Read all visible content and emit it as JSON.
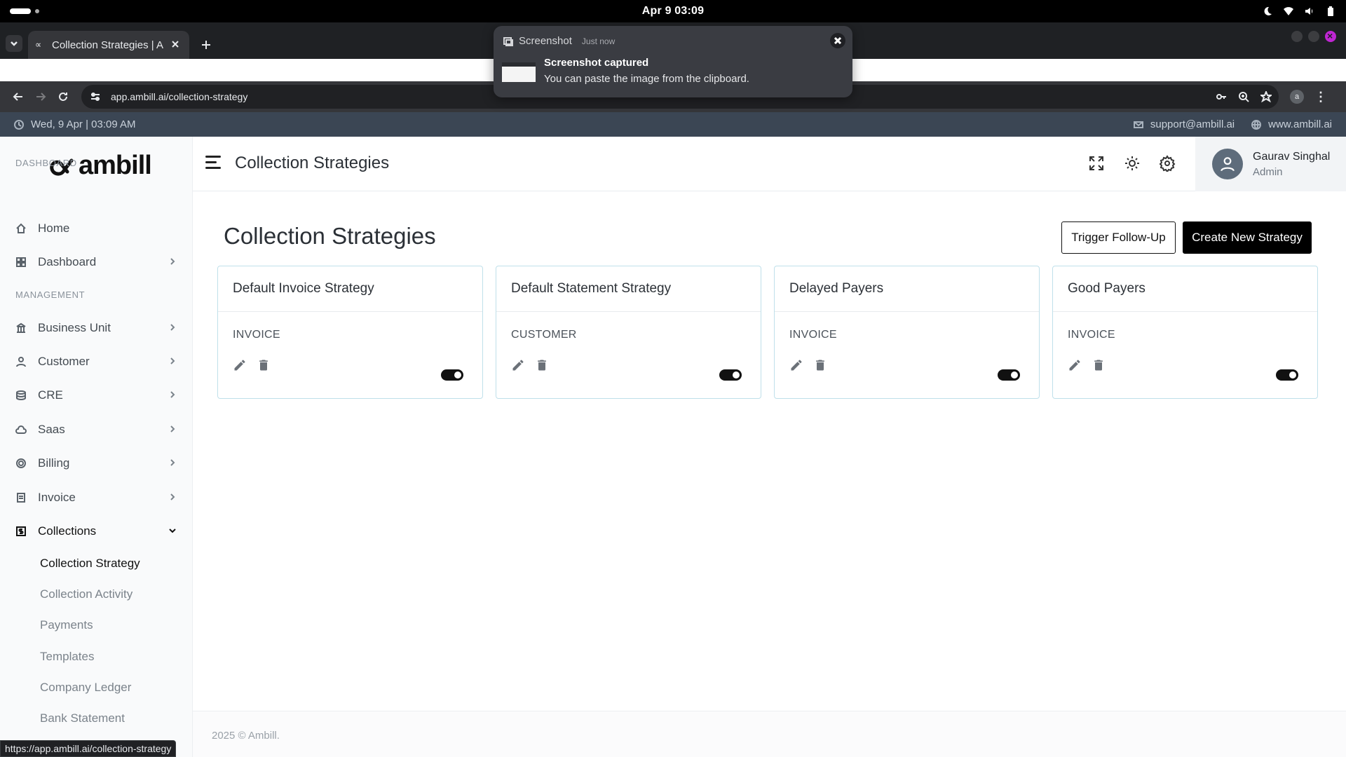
{
  "os": {
    "clock": "Apr 9  03:09"
  },
  "browser": {
    "tab_title": "Collection Strategies | Ar",
    "tab_favicon": "∝",
    "url": "app.ambill.ai/collection-strategy",
    "profile_initial": "a",
    "status_url": "https://app.ambill.ai/collection-strategy"
  },
  "notification": {
    "app": "Screenshot",
    "time": "Just now",
    "title": "Screenshot captured",
    "body": "You can paste the image from the clipboard."
  },
  "infobar": {
    "datetime": "Wed, 9 Apr | 03:09 AM",
    "support_email": "support@ambill.ai",
    "website": "www.ambill.ai"
  },
  "sidebar": {
    "logo": "ambill",
    "section_dashboard": "DASHBOARD",
    "section_management": "MANAGEMENT",
    "items": [
      {
        "label": "Home",
        "icon": "home-icon"
      },
      {
        "label": "Dashboard",
        "icon": "grid-icon"
      },
      {
        "label": "Business Unit",
        "icon": "bank-icon"
      },
      {
        "label": "Customer",
        "icon": "user-icon"
      },
      {
        "label": "CRE",
        "icon": "database-icon"
      },
      {
        "label": "Saas",
        "icon": "cloud-icon"
      },
      {
        "label": "Billing",
        "icon": "billing-icon"
      },
      {
        "label": "Invoice",
        "icon": "invoice-icon"
      },
      {
        "label": "Collections",
        "icon": "collections-icon"
      }
    ],
    "sub_items": [
      {
        "label": "Collection Strategy"
      },
      {
        "label": "Collection Activity"
      },
      {
        "label": "Payments"
      },
      {
        "label": "Templates"
      },
      {
        "label": "Company Ledger"
      },
      {
        "label": "Bank Statement"
      }
    ]
  },
  "header": {
    "title": "Collection Strategies",
    "user_name": "Gaurav Singhal",
    "user_role": "Admin"
  },
  "main": {
    "title": "Collection Strategies",
    "trigger_label": "Trigger Follow-Up",
    "create_label": "Create New Strategy",
    "cards": [
      {
        "name": "Default Invoice Strategy",
        "type": "INVOICE",
        "enabled": true
      },
      {
        "name": "Default Statement Strategy",
        "type": "CUSTOMER",
        "enabled": true
      },
      {
        "name": "Delayed Payers",
        "type": "INVOICE",
        "enabled": true
      },
      {
        "name": "Good Payers",
        "type": "INVOICE",
        "enabled": true
      }
    ]
  },
  "footer": {
    "text": "2025 © Ambill."
  },
  "colors": {
    "accent": "#000000",
    "card_border": "#bfe0ea",
    "infobar_bg": "#3b4654"
  }
}
